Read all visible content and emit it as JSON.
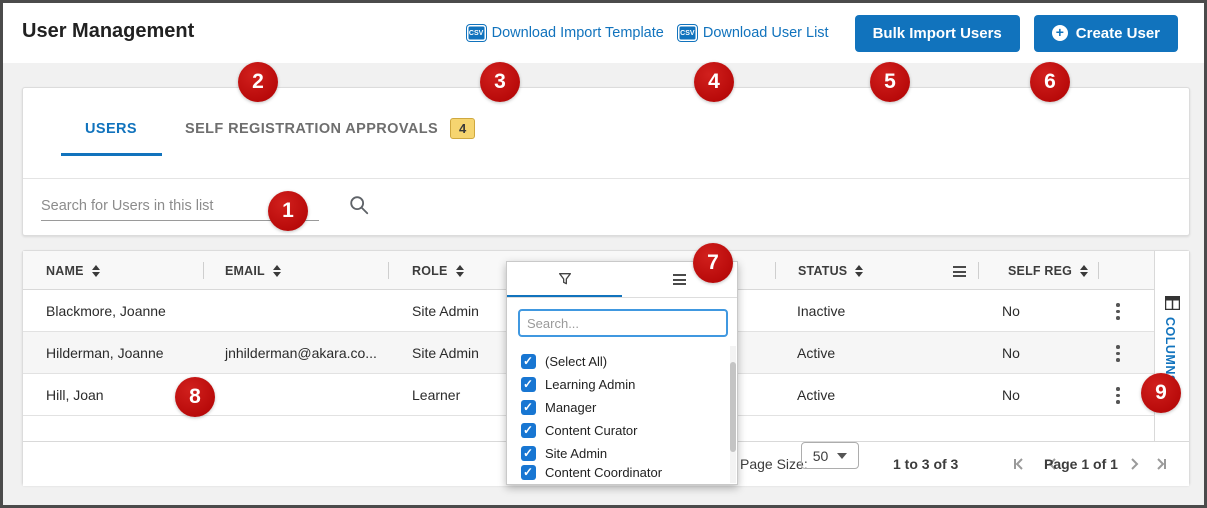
{
  "header": {
    "title": "User Management",
    "csv_icon_text": "CSV",
    "links": [
      {
        "label": "Download Import Template"
      },
      {
        "label": "Download User List"
      }
    ],
    "buttons": [
      {
        "label": "Bulk Import Users"
      },
      {
        "label": "Create User"
      }
    ]
  },
  "tabs": {
    "users": "USERS",
    "self_reg": "SELF REGISTRATION APPROVALS",
    "self_reg_badge": "4"
  },
  "search": {
    "placeholder": "Search for Users in this list"
  },
  "table": {
    "columns": {
      "name": "NAME",
      "email": "EMAIL",
      "role": "ROLE",
      "status": "STATUS",
      "self_reg": "SELF REG"
    },
    "rows": [
      {
        "name": "Blackmore, Joanne",
        "email": "",
        "role": "Site Admin",
        "status": "Inactive",
        "self_reg": "No"
      },
      {
        "name": "Hilderman, Joanne",
        "email": "jnhilderman@akara.co...",
        "role": "Site Admin",
        "status": "Active",
        "self_reg": "No"
      },
      {
        "name": "Hill, Joan",
        "email": "",
        "role": "Learner",
        "status": "Active",
        "self_reg": "No"
      }
    ]
  },
  "filter_popup": {
    "search_placeholder": "Search...",
    "options": [
      {
        "label": "(Select All)",
        "checked": true
      },
      {
        "label": "Learning Admin",
        "checked": true
      },
      {
        "label": "Manager",
        "checked": true
      },
      {
        "label": "Content Curator",
        "checked": true
      },
      {
        "label": "Site Admin",
        "checked": true
      },
      {
        "label": "Content Coordinator",
        "checked": true
      }
    ]
  },
  "side_panel": {
    "label": "COLUMNS"
  },
  "pagination": {
    "page_size_label": "Page Size:",
    "page_size": "50",
    "range": "1 to 3 of 3",
    "page": "Page 1 of 1"
  },
  "annotations": [
    {
      "label": "1"
    },
    {
      "label": "2"
    },
    {
      "label": "3"
    },
    {
      "label": "4"
    },
    {
      "label": "5"
    },
    {
      "label": "6"
    },
    {
      "label": "7"
    },
    {
      "label": "8"
    },
    {
      "label": "9"
    }
  ],
  "colors": {
    "accent_blue": "#1173bd",
    "annotation_red": "#bb0c0c",
    "badge_bg": "#f6d570",
    "badge_border": "#cfa83f",
    "status_header_bg": "#f8f8f8"
  }
}
